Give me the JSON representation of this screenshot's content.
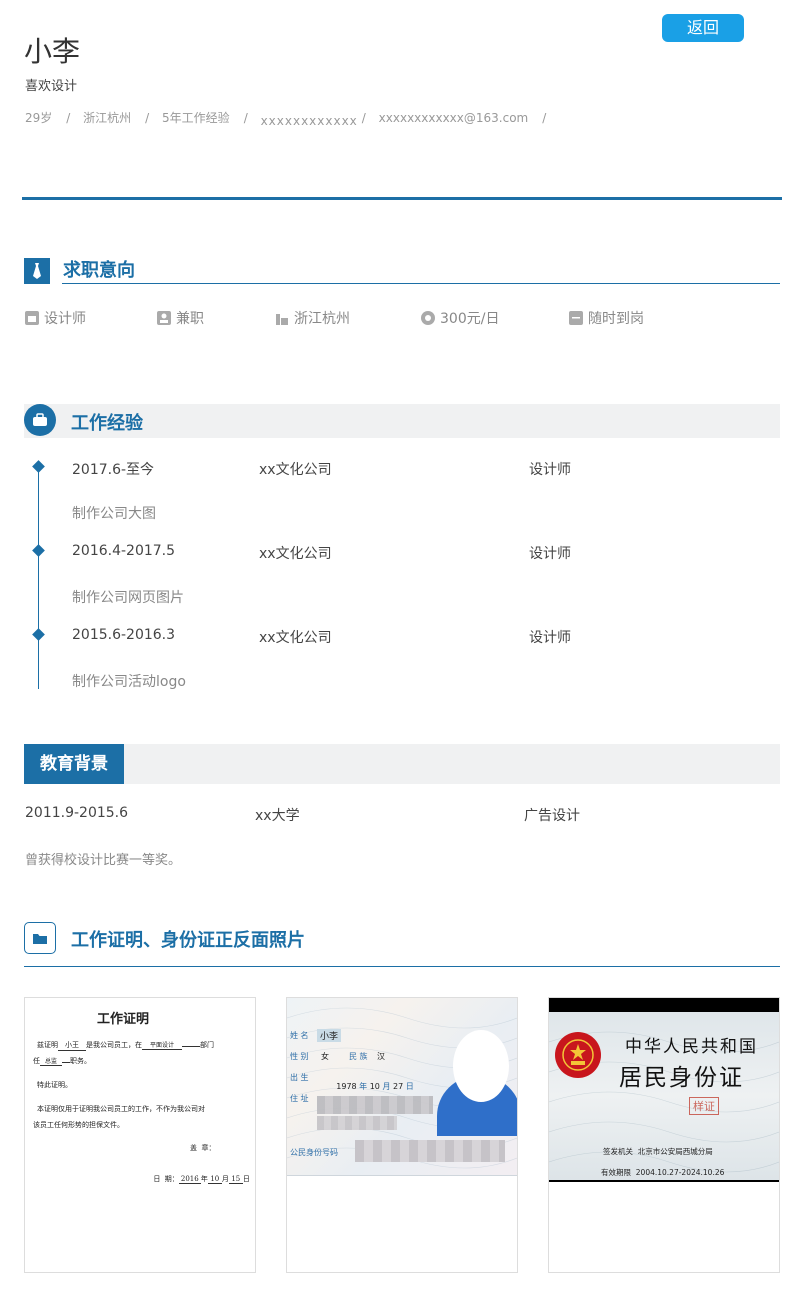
{
  "header": {
    "back_label": "返回",
    "name": "小李",
    "tagline": "喜欢设计",
    "meta": [
      "29岁",
      "浙江杭州",
      "5年工作经验",
      "xxxxxxxxxxxx",
      "xxxxxxxxxxxx@163.com"
    ]
  },
  "intent": {
    "title": "求职意向",
    "items": [
      {
        "icon": "position-icon",
        "label": "设计师"
      },
      {
        "icon": "employment-type-icon",
        "label": "兼职"
      },
      {
        "icon": "city-icon",
        "label": "浙江杭州"
      },
      {
        "icon": "salary-icon",
        "label": "300元/日"
      },
      {
        "icon": "calendar-icon",
        "label": "随时到岗"
      }
    ]
  },
  "work": {
    "title": "工作经验",
    "items": [
      {
        "period": "2017.6-至今",
        "company": "xx文化公司",
        "role": "设计师",
        "desc": "制作公司大图"
      },
      {
        "period": "2016.4-2017.5",
        "company": "xx文化公司",
        "role": "设计师",
        "desc": "制作公司网页图片"
      },
      {
        "period": "2015.6-2016.3",
        "company": "xx文化公司",
        "role": "设计师",
        "desc": "制作公司活动logo"
      }
    ]
  },
  "education": {
    "title": "教育背景",
    "period": "2011.9-2015.6",
    "school": "xx大学",
    "major": "广告设计",
    "desc": "曾获得校设计比赛一等奖。"
  },
  "proof": {
    "title": "工作证明、身份证正反面照片",
    "certificate": {
      "title": "工作证明",
      "line1a": "兹证明",
      "line1_name": "小王",
      "line1b": "是我公司员工，在",
      "line1_dept": "平面设计",
      "line1c": "部门",
      "line2a": "任",
      "line2_pos": "总监",
      "line2b": "职务。",
      "line3": "特此证明。",
      "line4": "本证明仅用于证明我公司员工的工作，不作为我公司对",
      "line5": "该员工任何形势的担保文件。",
      "seal": "盖  章：",
      "date_label": "日  期：",
      "date_y": "2016",
      "date_y_unit": "年",
      "date_m": "10",
      "date_m_unit": "月",
      "date_d": "15",
      "date_d_unit": "日"
    },
    "id_front": {
      "name_label": "姓 名",
      "name": "小李",
      "sex_label": "性 别",
      "sex": "女",
      "ethnic_label": "民 族",
      "ethnic": "汉",
      "birth_label": "出 生",
      "birth_y": "1978",
      "birth_y_unit": "年",
      "birth_m": "10",
      "birth_m_unit": "月",
      "birth_d": "27",
      "birth_d_unit": "日",
      "addr_label": "住 址",
      "id_label": "公民身份号码"
    },
    "id_back": {
      "title1": "中华人民共和国",
      "title2": "居民身份证",
      "stamp": "样证",
      "issuer_label": "签发机关",
      "issuer": "北京市公安局西城分局",
      "valid_label": "有效期限",
      "valid": "2004.10.27-2024.10.26"
    }
  },
  "colors": {
    "primary": "#1c6fa6",
    "back_button": "#1aa0e6"
  }
}
